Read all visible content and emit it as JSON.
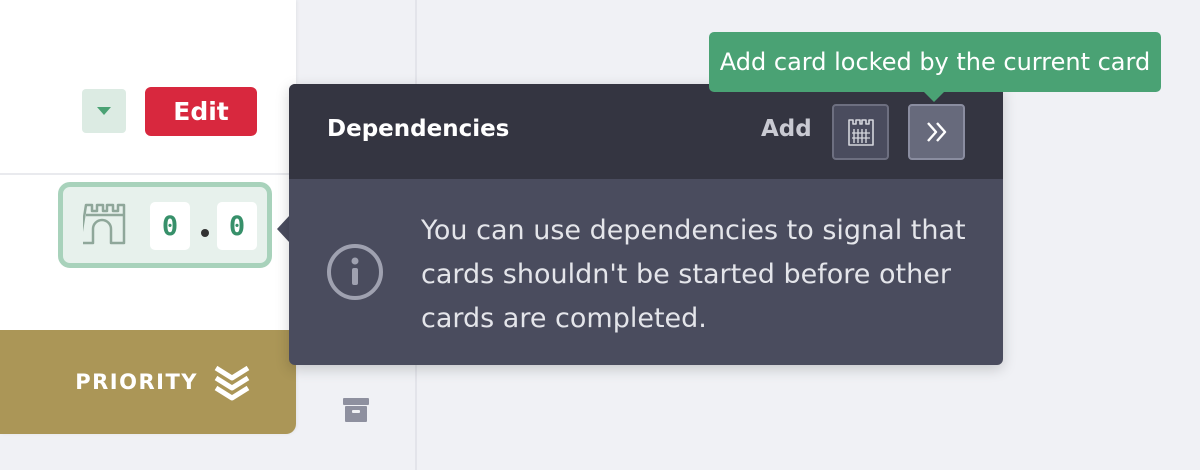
{
  "card": {
    "edit_label": "Edit",
    "priority_label": "PRIORITY",
    "dependencies": {
      "locked_count": "0",
      "blocking_count": "0"
    }
  },
  "popover": {
    "title": "Dependencies",
    "add_label": "Add",
    "message": "You can use dependencies to signal that cards shouldn't be started before other cards are completed."
  },
  "tooltip": {
    "text": "Add card locked by the current card"
  },
  "colors": {
    "edit_red": "#d8283e",
    "priority_gold": "#ab9657",
    "dep_green": "#a8d2bb",
    "tooltip_green": "#4aa274",
    "popover_header": "#343541",
    "popover_body": "#4a4c5e"
  },
  "icons": [
    "chevron-down-icon",
    "castle-icon",
    "priority-chevrons-icon",
    "archive-icon",
    "lock-icon",
    "double-chevron-right-icon",
    "info-icon"
  ]
}
